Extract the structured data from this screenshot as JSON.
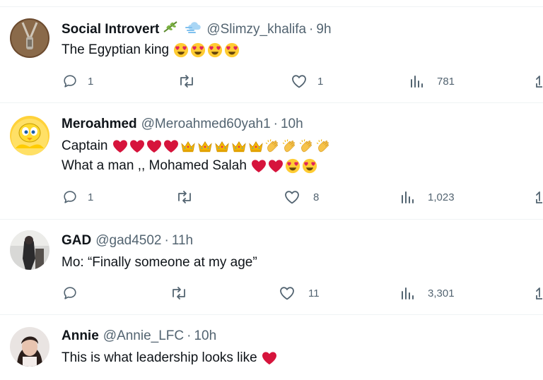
{
  "colors": {
    "text": "#0f1419",
    "secondary": "#536471",
    "divider": "#eff3f4",
    "heart": "#d6143c"
  },
  "tweets": [
    {
      "name": "Social Introvert",
      "name_icons": [
        "olive-branch-icon",
        "dash-cloud-icon"
      ],
      "handle": "@Slimzy_khalifa",
      "dot": "·",
      "time": "9h",
      "lines": [
        {
          "text": "The Egyptian king",
          "emojis": [
            "heart-eyes",
            "heart-eyes",
            "heart-eyes",
            "heart-eyes"
          ]
        }
      ],
      "replies": "1",
      "retweets": "",
      "likes": "1",
      "views": "781"
    },
    {
      "name": "Meroahmed",
      "name_icons": [],
      "handle": "@Meroahmed60yah1",
      "dot": "·",
      "time": "10h",
      "lines": [
        {
          "text": "Captain",
          "emojis": [
            "red-heart",
            "red-heart",
            "red-heart",
            "red-heart",
            "crown",
            "crown",
            "crown",
            "crown",
            "crown",
            "clapping-hands",
            "clapping-hands",
            "clapping-hands",
            "clapping-hands"
          ]
        },
        {
          "text": "What a man ,, Mohamed Salah",
          "emojis": [
            "red-heart",
            "red-heart",
            "heart-eyes",
            "heart-eyes"
          ]
        }
      ],
      "replies": "1",
      "retweets": "",
      "likes": "8",
      "views": "1,023"
    },
    {
      "name": "GAD",
      "name_icons": [],
      "handle": "@gad4502",
      "dot": "·",
      "time": "11h",
      "lines": [
        {
          "text": "Mo: “Finally someone at my age”",
          "emojis": []
        }
      ],
      "replies": "",
      "retweets": "",
      "likes": "11",
      "views": "3,301"
    },
    {
      "name": "Annie",
      "name_icons": [],
      "handle": "@Annie_LFC",
      "dot": "·",
      "time": "10h",
      "lines": [
        {
          "text": "This is what leadership looks like",
          "emojis": [
            "red-heart"
          ]
        }
      ]
    }
  ]
}
